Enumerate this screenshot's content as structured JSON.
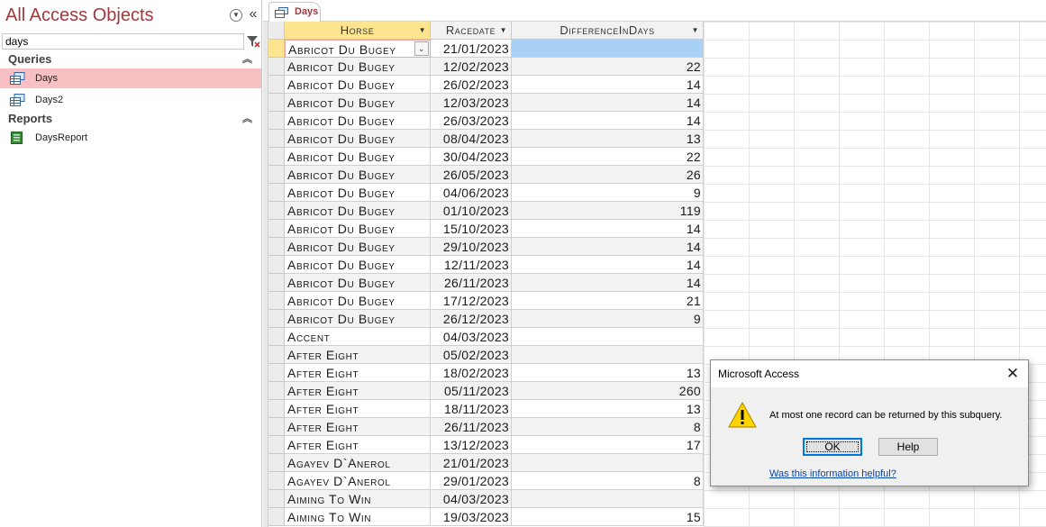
{
  "nav": {
    "title": "All Access Objects",
    "search_value": "days",
    "groups": [
      {
        "label": "Queries",
        "items": [
          "Days",
          "Days2"
        ]
      },
      {
        "label": "Reports",
        "items": [
          "DaysReport"
        ]
      }
    ],
    "selected_item": "Days"
  },
  "document": {
    "tab_label": "Days",
    "columns": [
      "Horse",
      "Racedate",
      "DifferenceInDays"
    ],
    "rows": [
      {
        "horse": "Abricot Du Bugey",
        "racedate": "21/01/2023",
        "diff": ""
      },
      {
        "horse": "Abricot Du Bugey",
        "racedate": "12/02/2023",
        "diff": "22"
      },
      {
        "horse": "Abricot Du Bugey",
        "racedate": "26/02/2023",
        "diff": "14"
      },
      {
        "horse": "Abricot Du Bugey",
        "racedate": "12/03/2023",
        "diff": "14"
      },
      {
        "horse": "Abricot Du Bugey",
        "racedate": "26/03/2023",
        "diff": "14"
      },
      {
        "horse": "Abricot Du Bugey",
        "racedate": "08/04/2023",
        "diff": "13"
      },
      {
        "horse": "Abricot Du Bugey",
        "racedate": "30/04/2023",
        "diff": "22"
      },
      {
        "horse": "Abricot Du Bugey",
        "racedate": "26/05/2023",
        "diff": "26"
      },
      {
        "horse": "Abricot Du Bugey",
        "racedate": "04/06/2023",
        "diff": "9"
      },
      {
        "horse": "Abricot Du Bugey",
        "racedate": "01/10/2023",
        "diff": "119"
      },
      {
        "horse": "Abricot Du Bugey",
        "racedate": "15/10/2023",
        "diff": "14"
      },
      {
        "horse": "Abricot Du Bugey",
        "racedate": "29/10/2023",
        "diff": "14"
      },
      {
        "horse": "Abricot Du Bugey",
        "racedate": "12/11/2023",
        "diff": "14"
      },
      {
        "horse": "Abricot Du Bugey",
        "racedate": "26/11/2023",
        "diff": "14"
      },
      {
        "horse": "Abricot Du Bugey",
        "racedate": "17/12/2023",
        "diff": "21"
      },
      {
        "horse": "Abricot Du Bugey",
        "racedate": "26/12/2023",
        "diff": "9"
      },
      {
        "horse": "Accent",
        "racedate": "04/03/2023",
        "diff": ""
      },
      {
        "horse": "After Eight",
        "racedate": "05/02/2023",
        "diff": ""
      },
      {
        "horse": "After Eight",
        "racedate": "18/02/2023",
        "diff": "13"
      },
      {
        "horse": "After Eight",
        "racedate": "05/11/2023",
        "diff": "260"
      },
      {
        "horse": "After Eight",
        "racedate": "18/11/2023",
        "diff": "13"
      },
      {
        "horse": "After Eight",
        "racedate": "26/11/2023",
        "diff": "8"
      },
      {
        "horse": "After Eight",
        "racedate": "13/12/2023",
        "diff": "17"
      },
      {
        "horse": "Agayev D`Anerol",
        "racedate": "21/01/2023",
        "diff": ""
      },
      {
        "horse": "Agayev D`Anerol",
        "racedate": "29/01/2023",
        "diff": "8"
      },
      {
        "horse": "Aiming To Win",
        "racedate": "04/03/2023",
        "diff": ""
      },
      {
        "horse": "Aiming To Win",
        "racedate": "19/03/2023",
        "diff": "15"
      }
    ]
  },
  "dialog": {
    "title": "Microsoft Access",
    "message": "At most one record can be returned by this subquery.",
    "ok_label": "OK",
    "help_label": "Help",
    "link_text": "Was this information helpful?"
  },
  "icons": {
    "nav_menu": "chevron-down-circle-icon",
    "nav_collapse": "double-chevron-left-icon",
    "search_clear": "clear-filter-icon",
    "query": "query-icon",
    "report": "report-icon",
    "warning": "warning-triangle-icon",
    "close": "close-icon"
  },
  "colors": {
    "accent": "#a4373a",
    "selected_nav": "#f9c0c3",
    "selected_header": "#fde590",
    "selected_cell": "#a9d0f5",
    "link": "#0645ad"
  }
}
